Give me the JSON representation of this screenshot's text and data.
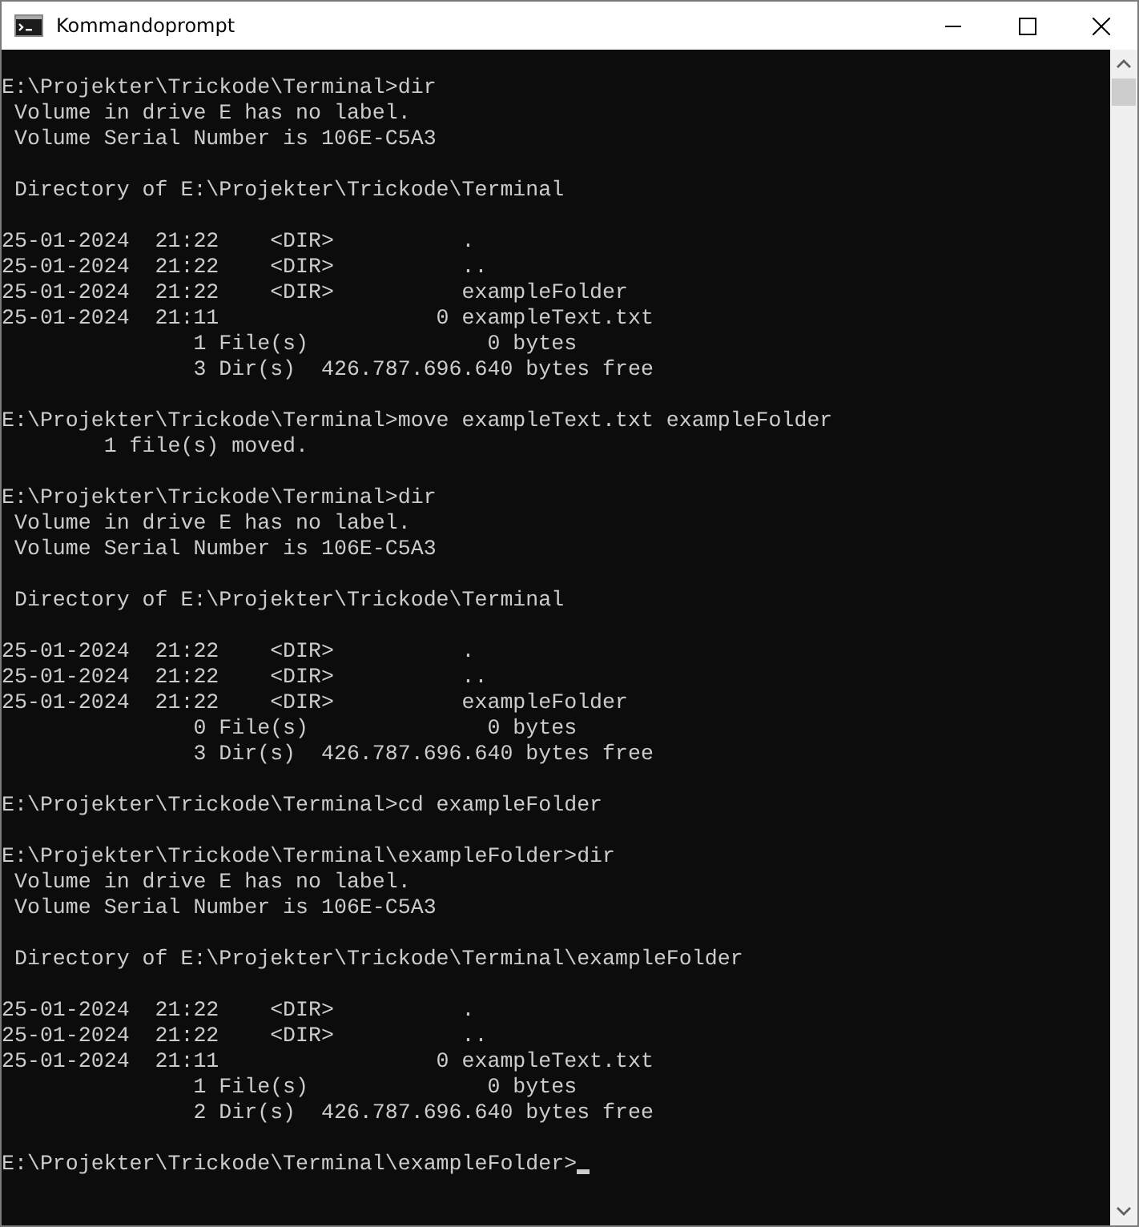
{
  "window": {
    "title": "Kommandoprompt"
  },
  "terminal": {
    "blocks": [
      [
        "E:\\Projekter\\Trickode\\Terminal>dir",
        " Volume in drive E has no label.",
        " Volume Serial Number is 106E-C5A3"
      ],
      [
        " Directory of E:\\Projekter\\Trickode\\Terminal"
      ],
      [
        "25-01-2024  21:22    <DIR>          .",
        "25-01-2024  21:22    <DIR>          ..",
        "25-01-2024  21:22    <DIR>          exampleFolder",
        "25-01-2024  21:11                 0 exampleText.txt",
        "               1 File(s)              0 bytes",
        "               3 Dir(s)  426.787.696.640 bytes free"
      ],
      [
        "E:\\Projekter\\Trickode\\Terminal>move exampleText.txt exampleFolder",
        "        1 file(s) moved."
      ],
      [
        "E:\\Projekter\\Trickode\\Terminal>dir",
        " Volume in drive E has no label.",
        " Volume Serial Number is 106E-C5A3"
      ],
      [
        " Directory of E:\\Projekter\\Trickode\\Terminal"
      ],
      [
        "25-01-2024  21:22    <DIR>          .",
        "25-01-2024  21:22    <DIR>          ..",
        "25-01-2024  21:22    <DIR>          exampleFolder",
        "               0 File(s)              0 bytes",
        "               3 Dir(s)  426.787.696.640 bytes free"
      ],
      [
        "E:\\Projekter\\Trickode\\Terminal>cd exampleFolder"
      ],
      [
        "E:\\Projekter\\Trickode\\Terminal\\exampleFolder>dir",
        " Volume in drive E has no label.",
        " Volume Serial Number is 106E-C5A3"
      ],
      [
        " Directory of E:\\Projekter\\Trickode\\Terminal\\exampleFolder"
      ],
      [
        "25-01-2024  21:22    <DIR>          .",
        "25-01-2024  21:22    <DIR>          ..",
        "25-01-2024  21:11                 0 exampleText.txt",
        "               1 File(s)              0 bytes",
        "               2 Dir(s)  426.787.696.640 bytes free"
      ]
    ],
    "prompt": "E:\\Projekter\\Trickode\\Terminal\\exampleFolder>"
  }
}
